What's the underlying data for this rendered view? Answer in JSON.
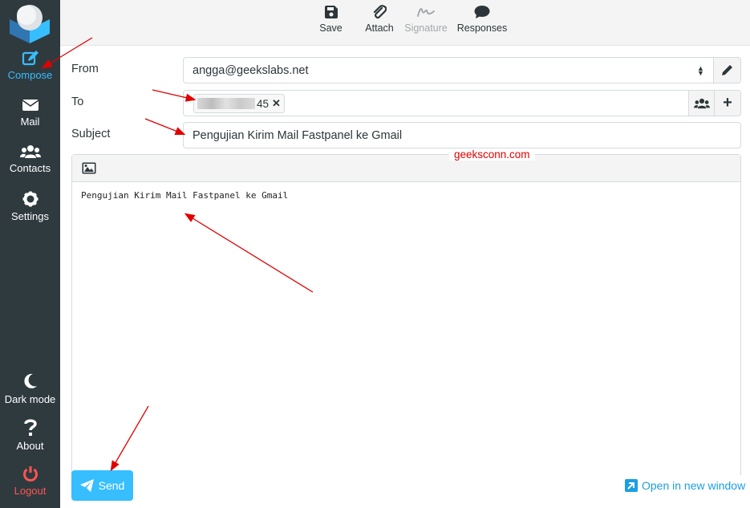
{
  "sidebar": {
    "items": [
      {
        "label": "Compose",
        "icon": "compose-icon",
        "active": true
      },
      {
        "label": "Mail",
        "icon": "envelope-icon"
      },
      {
        "label": "Contacts",
        "icon": "users-icon"
      },
      {
        "label": "Settings",
        "icon": "gear-icon"
      },
      {
        "label": "Dark mode",
        "icon": "moon-icon"
      },
      {
        "label": "About",
        "icon": "question-icon"
      },
      {
        "label": "Logout",
        "icon": "power-icon"
      }
    ]
  },
  "toolbar": {
    "save": "Save",
    "attach": "Attach",
    "signature": "Signature",
    "responses": "Responses"
  },
  "form": {
    "from_label": "From",
    "from_value": "angga@geekslabs.net",
    "to_label": "To",
    "recipient_visible": "45",
    "subject_label": "Subject",
    "subject_value": "Pengujian Kirim Mail Fastpanel ke Gmail"
  },
  "editor": {
    "body": "Pengujian Kirim Mail Fastpanel ke Gmail"
  },
  "watermark": "geeksconn.com",
  "footer": {
    "send": "Send",
    "open_window": "Open in new window"
  },
  "colors": {
    "sidebar_bg": "#2f3a3f",
    "accent": "#37beff",
    "logout": "#ff5552",
    "annotation": "#e00000"
  }
}
